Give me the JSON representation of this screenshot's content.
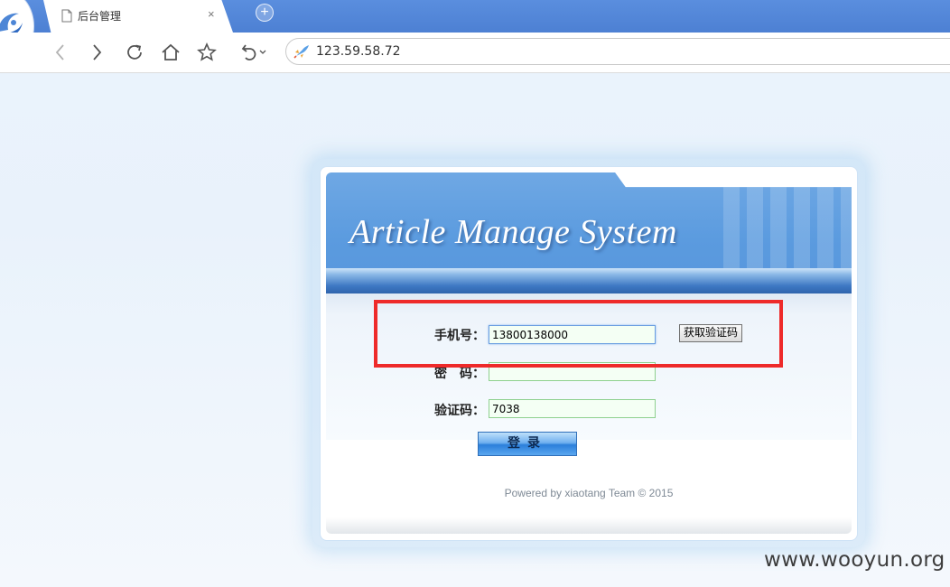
{
  "browser": {
    "tab_title": "后台管理",
    "tab_close": "×",
    "new_tab": "+",
    "address": "123.59.58.72",
    "icons": [
      "back-icon",
      "forward-icon",
      "refresh-icon",
      "home-icon",
      "star-icon",
      "undo-icon",
      "rocket-icon"
    ]
  },
  "login": {
    "system_title": "Article Manage System",
    "phone_label": "手机号：",
    "phone_value": "13800138000",
    "sms_button": "获取验证码",
    "password_label": "密　码：",
    "password_value": "",
    "captcha_label": "验证码：",
    "captcha_value": "7038",
    "login_button": "登录",
    "powered_by": "Powered by xiaotang Team © 2015"
  },
  "watermark": "www.wooyun.org",
  "colors": {
    "titlebar": "#5a8ede",
    "header_blue": "#5b9bdf",
    "highlight_red": "#ee2a2a",
    "field_border": "#8fd08f"
  }
}
